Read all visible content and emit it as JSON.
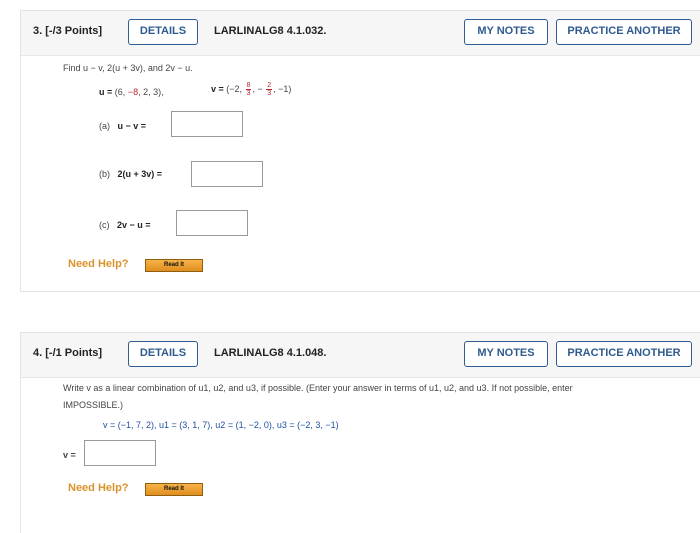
{
  "q3": {
    "number": "3.",
    "points": "[-/3 Points]",
    "details": "DETAILS",
    "code": "LARLINALG8 4.1.032.",
    "my_notes": "MY NOTES",
    "practice": "PRACTICE ANOTHER",
    "prompt": "Find u − v, 2(u + 3v), and 2v − u.",
    "u_label": "u =",
    "u_open": "(6,",
    "u_neg8": "−8,",
    "u_rest": "2, 3),",
    "v_label": "v =",
    "v_open": "(−2,",
    "f1_num": "8",
    "f1_den": "3",
    "minus": "−",
    "f2_num": "2",
    "f2_den": "3",
    "v_rest": ", −1)",
    "parts": [
      {
        "label": "(a)",
        "expr": "u − v ="
      },
      {
        "label": "(b)",
        "expr": "2(u + 3v) ="
      },
      {
        "label": "(c)",
        "expr": "2v − u ="
      }
    ],
    "need_help": "Need Help?",
    "read_it": "Read It"
  },
  "q4": {
    "number": "4.",
    "points": "[-/1 Points]",
    "details": "DETAILS",
    "code": "LARLINALG8 4.1.048.",
    "my_notes": "MY NOTES",
    "practice": "PRACTICE ANOTHER",
    "prompt_line1": "Write v as a linear combination of u1, u2, and u3, if possible. (Enter your answer in terms of u1, u2, and u3. If not possible, enter",
    "prompt_line2": "IMPOSSIBLE.)",
    "vectors": "v = (−1, 7, 2),   u1 = (3, 1, 7),   u2 = (1, −2, 0),   u3 = (−2, 3, −1)",
    "answer_label": "v =",
    "need_help": "Need Help?",
    "read_it": "Read It"
  }
}
